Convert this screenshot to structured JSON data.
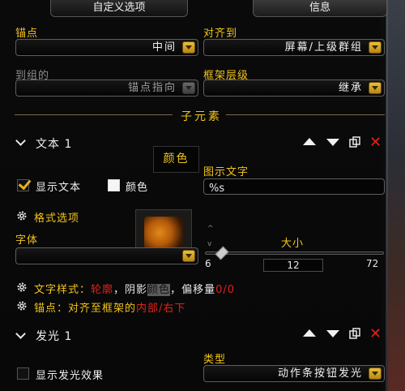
{
  "tabs": [
    {
      "label": "自定义选项",
      "active": true
    },
    {
      "label": "信息",
      "active": false
    }
  ],
  "anchor": {
    "label": "锚点",
    "value": "中间"
  },
  "align_to": {
    "label": "对齐到",
    "value": "屏幕/上级群组"
  },
  "to_group": {
    "label": "到组的",
    "value": "锚点指向"
  },
  "frame_strata": {
    "label": "框架层级",
    "value": "继承"
  },
  "sub_elements_title": "子元素",
  "text1": {
    "title": "文本 1",
    "color_button": "颜色",
    "show_text_label": "显示文本",
    "show_text_checked": true,
    "color_label": "颜色",
    "display_text_label": "图示文字",
    "display_text_value": "%s",
    "format_options_label": "格式选项",
    "font_label": "字体",
    "font_value": "",
    "size_label": "大小",
    "size_min": "6",
    "size_value": "12",
    "size_max": "72",
    "size_fraction": 0.09
  },
  "text_style_line": {
    "prefix": "文字样式：",
    "outline": "轮廓",
    "mid": "，阴影",
    "shadow": "颜色",
    "mid2": "，偏移量",
    "offset": "0/0"
  },
  "anchor_line": {
    "prefix": "锚点：对齐至框架的",
    "value": "内部/右下"
  },
  "glow1": {
    "title": "发光 1",
    "show_glow_label": "显示发光效果",
    "show_glow_checked": false,
    "type_label": "类型",
    "type_value": "动作条按钮发光"
  },
  "colors": {
    "gold": "#f3c418",
    "red": "#e0221a",
    "panel": "#0d0d0d"
  },
  "icons": [
    "chevron-down-icon",
    "arrow-up-icon",
    "arrow-down-icon",
    "copy-icon",
    "delete-icon",
    "gear-icon",
    "dropdown-arrow-icon"
  ]
}
